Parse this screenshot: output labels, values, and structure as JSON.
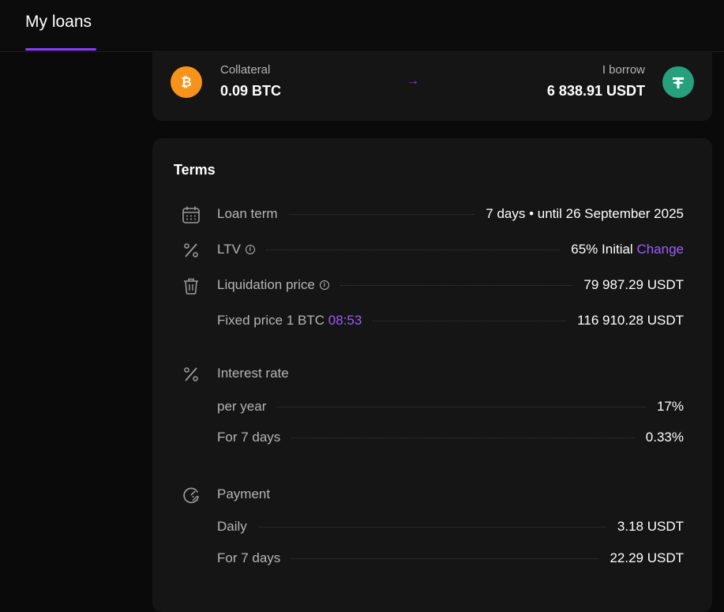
{
  "header": {
    "tab_label": "My loans"
  },
  "summary": {
    "collateral_label": "Collateral",
    "collateral_value": "0.09 BTC",
    "borrow_label": "I borrow",
    "borrow_value": "6 838.91 USDT",
    "btc_icon": "bitcoin-icon",
    "usdt_icon": "tether-icon",
    "arrow_glyph": "→"
  },
  "terms": {
    "title": "Terms",
    "loan_term": {
      "label": "Loan term",
      "value": "7 days • until 26 September 2025"
    },
    "ltv": {
      "label": "LTV",
      "value": "65% Initial",
      "action": "Change"
    },
    "liquidation": {
      "label": "Liquidation price",
      "value": "79 987.29 USDT"
    },
    "fixed_price": {
      "label": "Fixed price 1 BTC",
      "timer": "08:53",
      "value": "116 910.28 USDT"
    },
    "interest": {
      "title": "Interest rate",
      "per_year_label": "per year",
      "per_year_value": "17%",
      "days_label": "For 7 days",
      "days_value": "0.33%"
    },
    "payment": {
      "title": "Payment",
      "daily_label": "Daily",
      "daily_value": "3.18 USDT",
      "days_label": "For 7 days",
      "days_value": "22.29 USDT"
    }
  },
  "colors": {
    "accent": "#8b3dff",
    "btc": "#f7931a",
    "usdt": "#26a17b"
  }
}
